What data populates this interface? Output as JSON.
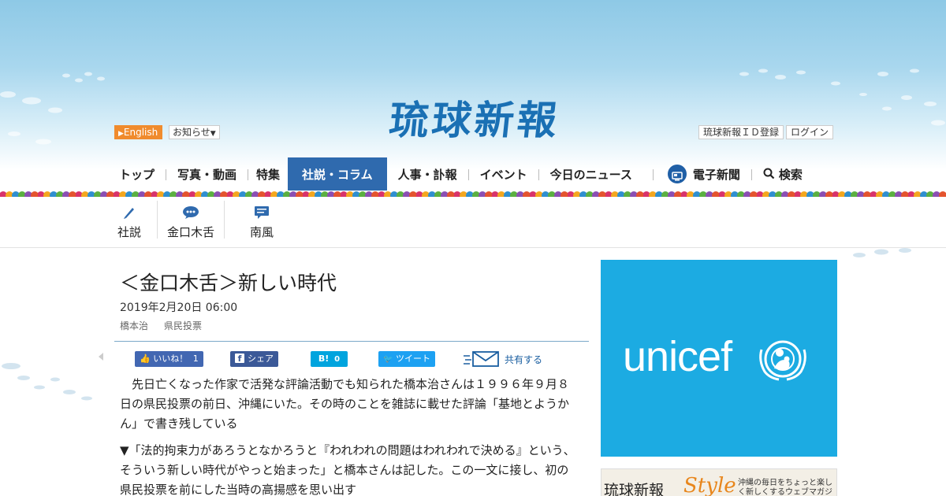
{
  "header": {
    "logo": "琉球新報",
    "english_label": "English",
    "notice_label": "お知らせ",
    "id_register_label": "琉球新報ＩＤ登録",
    "login_label": "ログイン"
  },
  "global_nav": {
    "items": [
      "トップ",
      "写真・動画",
      "特集",
      "社説・コラム",
      "人事・訃報",
      "イベント",
      "今日のニュース",
      "電子新聞",
      "検索"
    ],
    "active": "社説・コラム"
  },
  "sub_nav": {
    "items": [
      "社説",
      "金口木舌",
      "南風"
    ]
  },
  "article": {
    "title": "＜金口木舌＞新しい時代",
    "date": "2019年2月20日 06:00",
    "tags": [
      "橋本治",
      "県民投票"
    ],
    "paragraphs": [
      "　先日亡くなった作家で活発な評論活動でも知られた橋本治さんは１９９６年９月８日の県民投票の前日、沖縄にいた。その時のことを雑誌に載せた評論「基地とようかん」で書き残している",
      "▼「法的拘束力があろうとなかろうと『われわれの問題はわれわれで決める』という、そういう新しい時代がやっと始まった」と橋本さんは記した。この一文に接し、初の県民投票を前にした当時の高揚感を思い出す"
    ]
  },
  "share_bar": {
    "like_label": "いいね！",
    "like_count": "1",
    "fb_share_label": "シェア",
    "hatena_label": "B!",
    "hatena_count": "0",
    "tweet_label": "ツイート",
    "share_label": "共有する"
  },
  "ads": {
    "unicef_text": "unicef",
    "style_name": "琉球新報",
    "style_word": "Style",
    "style_sub": "沖縄の毎日をちょっと楽しく新しくするウェブマガジン"
  },
  "colors": {
    "brand_blue": "#1a70b4",
    "nav_active": "#2f6aae",
    "english_orange": "#f08b2d",
    "unicef_blue": "#1cabe2"
  }
}
